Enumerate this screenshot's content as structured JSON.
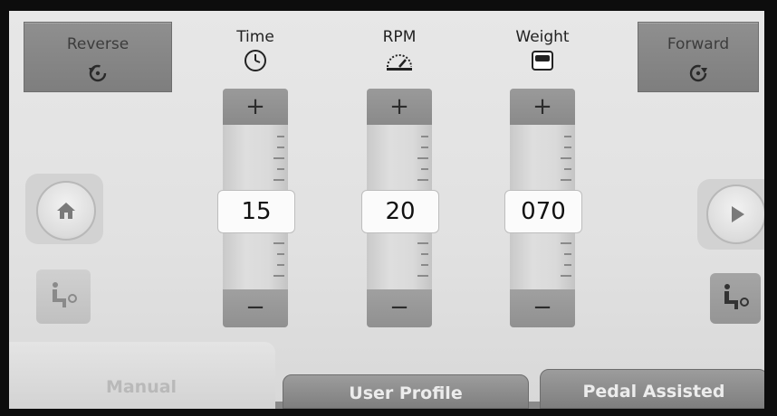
{
  "direction": {
    "reverse_label": "Reverse",
    "forward_label": "Forward",
    "reverse_icon": "rotate-ccw-icon",
    "forward_icon": "rotate-cw-icon"
  },
  "params": [
    {
      "label": "Time",
      "icon": "clock-icon",
      "value": "15",
      "increase": "+",
      "decrease": "−"
    },
    {
      "label": "RPM",
      "icon": "speedometer-icon",
      "value": "20",
      "increase": "+",
      "decrease": "−"
    },
    {
      "label": "Weight",
      "icon": "weight-icon",
      "value": "070",
      "increase": "+",
      "decrease": "−"
    }
  ],
  "side": {
    "home_icon": "home-icon",
    "play_icon": "play-icon",
    "seat_left_icon": "seat-icon",
    "seat_right_icon": "seat-icon"
  },
  "tabs": [
    {
      "label": "Manual",
      "active": true
    },
    {
      "label": "User Profile",
      "active": false
    },
    {
      "label": "Pedal Assisted",
      "active": false
    }
  ],
  "colors": {
    "background": "#e2e2e2",
    "button_dark": "#868686",
    "tab_inactive": "#8a8a8a"
  }
}
